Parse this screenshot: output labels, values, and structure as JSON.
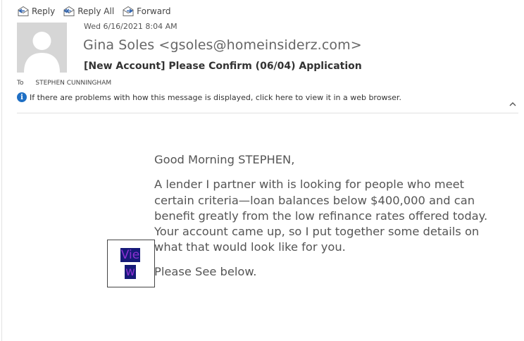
{
  "toolbar": {
    "reply_label": "Reply",
    "reply_all_label": "Reply All",
    "forward_label": "Forward"
  },
  "message": {
    "date": "Wed 6/16/2021 8:04 AM",
    "sender": "Gina Soles <gsoles@homeinsiderz.com>",
    "subject": "[New Account] Please Confirm (06/04) Application",
    "to_label": "To",
    "to_value": "STEPHEN CUNNINGHAM",
    "info_text": "If there are problems with how this message is displayed, click here to view it in a web browser."
  },
  "body": {
    "greeting": "Good Morning STEPHEN,",
    "paragraph": "A lender I partner with is looking for people who meet certain criteria—loan balances below $400,000 and can benefit greatly from the low refinance rates offered today. Your account came up, so I put together some details on what that would look like for you.",
    "closing": "Please See below."
  },
  "view_button": {
    "line1": "Vie",
    "line2": "w"
  },
  "icons": {
    "reply": "reply-icon",
    "reply_all": "reply-all-icon",
    "forward": "forward-icon",
    "avatar": "person-avatar-icon",
    "info": "info-icon",
    "chevron": "chevron-up-icon"
  },
  "colors": {
    "info_icon": "#1f6fc4",
    "view_link": "#8b2fd0",
    "view_highlight": "#151a78"
  }
}
